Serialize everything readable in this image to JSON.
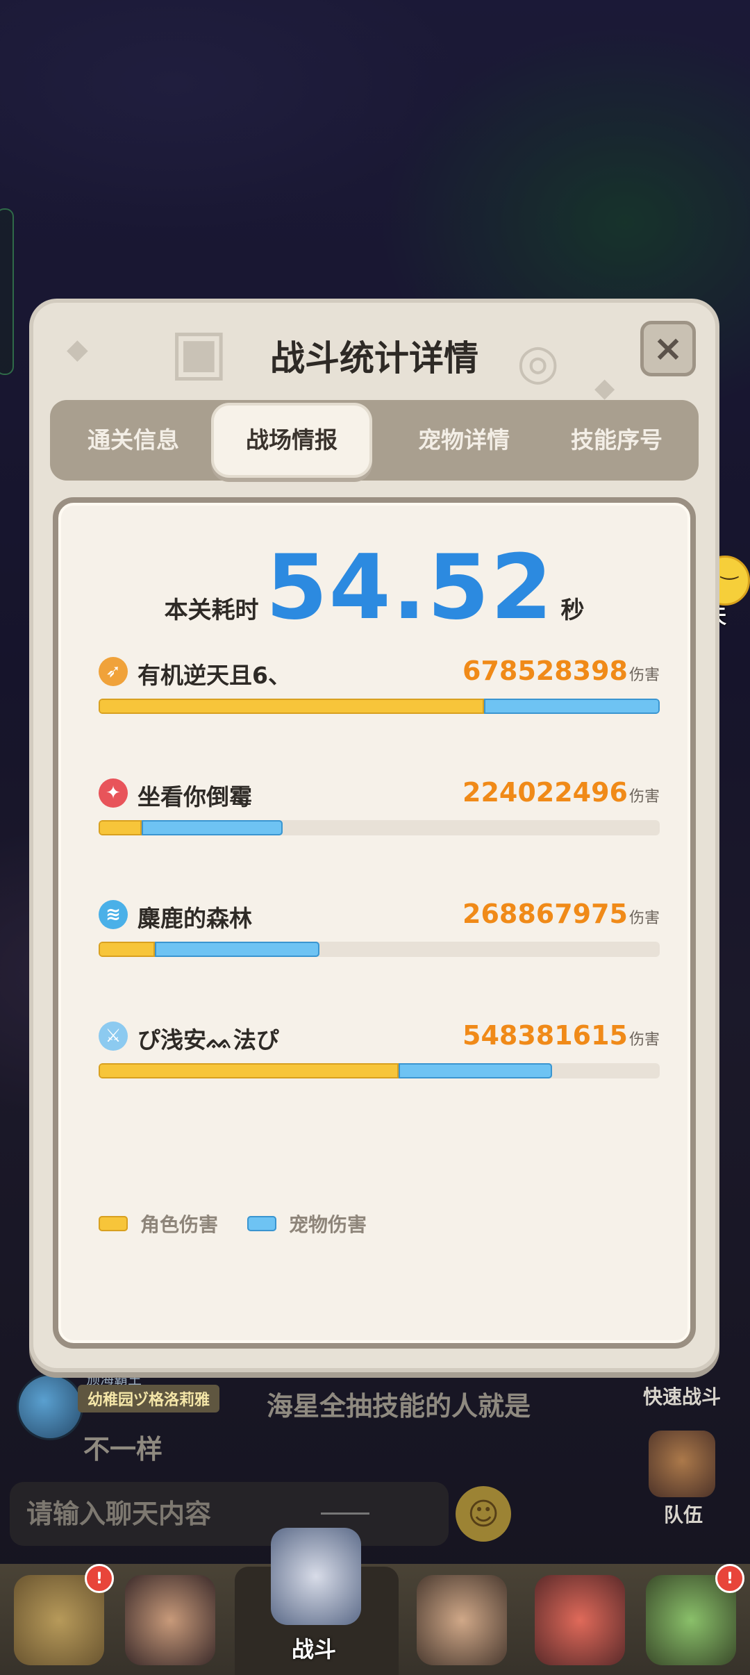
{
  "modal": {
    "title": "战斗统计详情",
    "close": "×",
    "tabs": [
      {
        "label": "通关信息"
      },
      {
        "label": "战场情报"
      },
      {
        "label": "宠物详情"
      },
      {
        "label": "技能序号"
      }
    ],
    "active_tab": 1,
    "time": {
      "label": "本关耗时",
      "value": "54.52",
      "unit": "秒"
    },
    "players": [
      {
        "name": "有机逆天且6、",
        "damage": "678528398",
        "damage_unit": "伤害",
        "icon": "bow-icon",
        "icon_color": "#f0a23a",
        "char_fraction": 0.687,
        "total_fraction": 1.0
      },
      {
        "name": "坐看你倒霉",
        "damage": "224022496",
        "damage_unit": "伤害",
        "icon": "wolf-icon",
        "icon_color": "#e8545a",
        "char_fraction": 0.077,
        "total_fraction": 0.328
      },
      {
        "name": "麋鹿的森林",
        "damage": "268867975",
        "damage_unit": "伤害",
        "icon": "swirl-icon",
        "icon_color": "#4ab0e8",
        "char_fraction": 0.1,
        "total_fraction": 0.394
      },
      {
        "name": "ぴ浅安ᨐ法ぴ",
        "damage": "548381615",
        "damage_unit": "伤害",
        "icon": "sword-icon",
        "icon_color": "#8ccaf0",
        "char_fraction": 0.535,
        "total_fraction": 0.808
      }
    ],
    "legend": {
      "char_label": "角色伤害",
      "pet_label": "宠物伤害"
    },
    "colors": {
      "char": "#f7c53a",
      "pet": "#6ec3f3",
      "time": "#2c8ae0",
      "damage": "#f08a18"
    }
  },
  "chat_button": {
    "label": "聊天"
  },
  "chat_message": {
    "badge_top": "颁海霸王",
    "sender": "幼稚园ヅ格洛莉雅",
    "text_line1": "海星全抽技能的人就是",
    "text_line2": "不一样"
  },
  "quick_battle": "快速战斗",
  "team": "队伍",
  "chat_input": {
    "placeholder": "请输入聊天内容"
  },
  "nav": {
    "battle_label": "战斗",
    "badges": [
      "!",
      "!"
    ]
  }
}
